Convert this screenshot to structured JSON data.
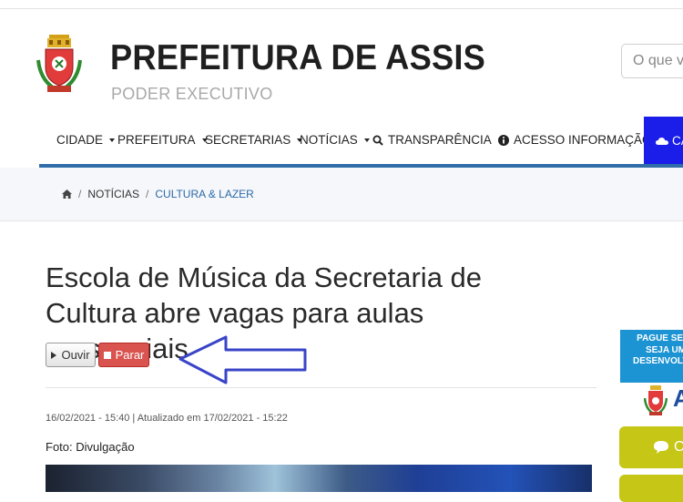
{
  "header": {
    "title": "PREFEITURA DE ASSIS",
    "subtitle": "PODER EXECUTIVO",
    "search_placeholder": "O que você procura?"
  },
  "nav": {
    "items": [
      {
        "label": "CIDADE"
      },
      {
        "label": "PREFEITURA"
      },
      {
        "label": "SECRETARIAS"
      },
      {
        "label": "NOTÍCIAS"
      },
      {
        "label": "TRANSPARÊNCIA"
      },
      {
        "label": "ACESSO INFORMAÇÃO"
      }
    ],
    "cta_label": "CA"
  },
  "breadcrumb": {
    "items": [
      "NOTÍCIAS",
      "CULTURA & LAZER"
    ]
  },
  "article": {
    "title": "Escola de Música da Secretaria de Cultura abre vagas para aulas presenciais",
    "listen_label": "Ouvir",
    "stop_label": "Parar",
    "meta": "16/02/2021 - 15:40 | Atualizado em 17/02/2021 - 15:22",
    "photo_credit": "Foto: Divulgação"
  },
  "sidebar": {
    "banner_lines": [
      "PAGUE SEU I",
      "SEJA UM",
      "DESENVOLVIM"
    ],
    "banner_letter": "A",
    "button_label": "C"
  },
  "colors": {
    "nav_active": "#1a1ee8",
    "accent_line": "#2f6ea8",
    "stop_button": "#d9534f",
    "sidebar_banner": "#1c93d2",
    "sidebar_button": "#c6c617",
    "annotation_arrow": "#3a44c8"
  }
}
